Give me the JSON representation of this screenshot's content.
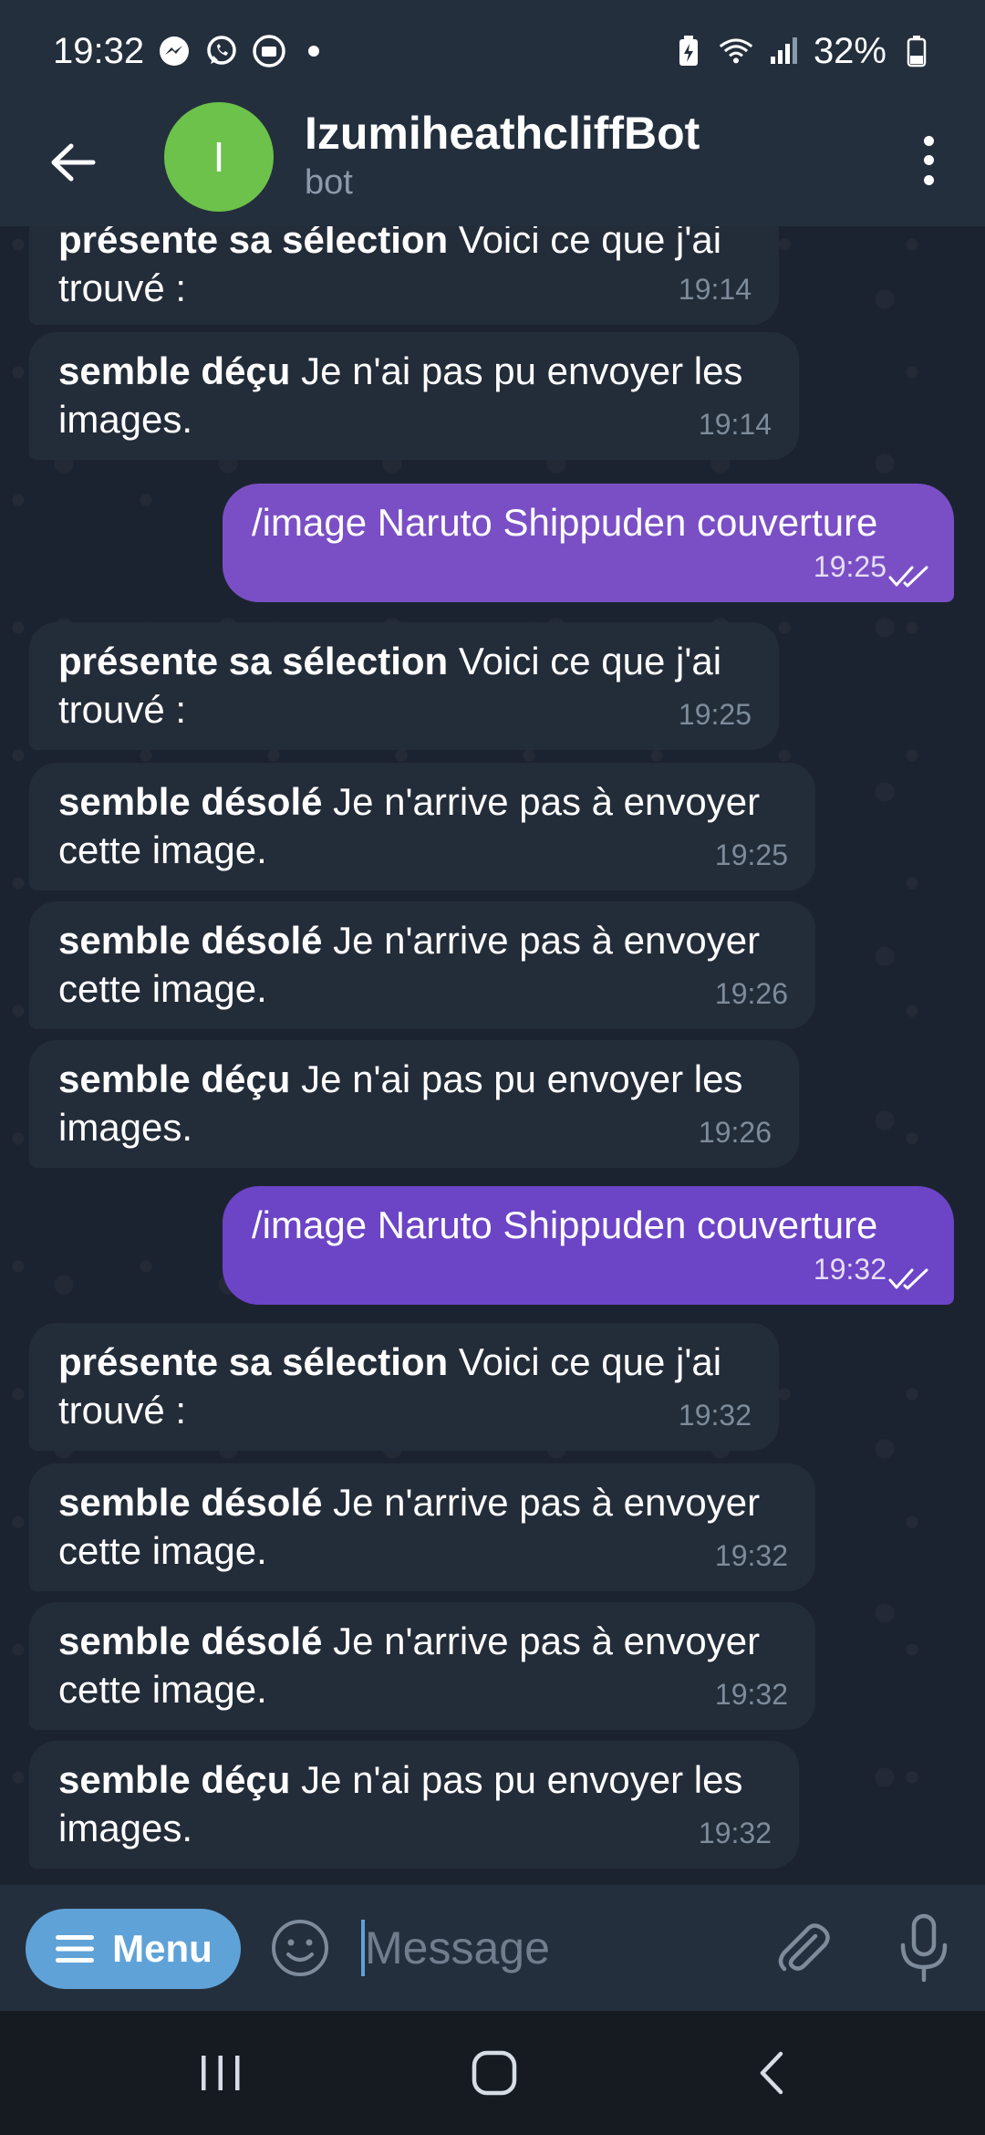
{
  "status_bar": {
    "time": "19:32",
    "battery": "32%",
    "left_icons": [
      "messenger-icon",
      "whatsapp-icon",
      "tv-icon"
    ],
    "right_icons": [
      "battery-saver-icon",
      "wifi-icon",
      "signal-icon",
      "battery-icon"
    ]
  },
  "header": {
    "avatar_letter": "I",
    "avatar_color": "#6cc24a",
    "title": "IzumiheathcliffBot",
    "subtitle": "bot"
  },
  "messages": [
    {
      "dir": "in",
      "bold": "présente sa sélection",
      "text": " Voici ce que j'ai trouvé :",
      "time": "19:14"
    },
    {
      "dir": "in",
      "bold": "semble déçu",
      "text": " Je n'ai pas pu envoyer les images.",
      "time": "19:14"
    },
    {
      "dir": "out",
      "bold": "",
      "text": "/image Naruto Shippuden couverture",
      "time": "19:25"
    },
    {
      "dir": "in",
      "bold": "présente sa sélection",
      "text": " Voici ce que j'ai trouvé :",
      "time": "19:25"
    },
    {
      "dir": "in",
      "bold": "semble désolé",
      "text": " Je n'arrive pas à envoyer cette image.",
      "time": "19:25"
    },
    {
      "dir": "in",
      "bold": "semble désolé",
      "text": " Je n'arrive pas à envoyer cette image.",
      "time": "19:26"
    },
    {
      "dir": "in",
      "bold": "semble déçu",
      "text": " Je n'ai pas pu envoyer les images.",
      "time": "19:26"
    },
    {
      "dir": "out",
      "bold": "",
      "text": "/image Naruto Shippuden couverture",
      "time": "19:32"
    },
    {
      "dir": "in",
      "bold": "présente sa sélection",
      "text": " Voici ce que j'ai trouvé :",
      "time": "19:32"
    },
    {
      "dir": "in",
      "bold": "semble désolé",
      "text": " Je n'arrive pas à envoyer cette image.",
      "time": "19:32"
    },
    {
      "dir": "in",
      "bold": "semble désolé",
      "text": " Je n'arrive pas à envoyer cette image.",
      "time": "19:32"
    },
    {
      "dir": "in",
      "bold": "semble déçu",
      "text": " Je n'ai pas pu envoyer les images.",
      "time": "19:32"
    }
  ],
  "input_bar": {
    "menu_label": "Menu",
    "placeholder": "Message",
    "value": ""
  },
  "colors": {
    "incoming_bubble": "#232c39",
    "outgoing_bubble": "#7a4fc6",
    "accent": "#5fa2d8"
  }
}
